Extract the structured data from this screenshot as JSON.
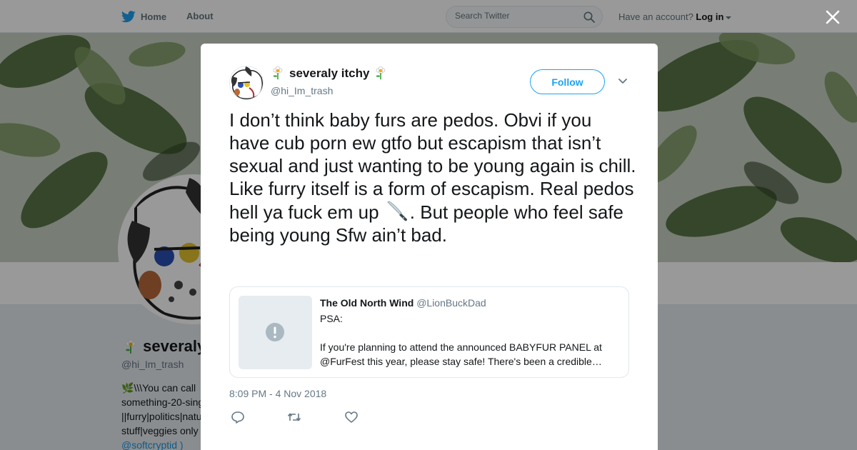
{
  "topbar": {
    "home_label": "Home",
    "about_label": "About",
    "search_placeholder": "Search Twitter",
    "account_prompt": "Have an account?",
    "login_label": "Log in"
  },
  "profile": {
    "name": "severaly",
    "handle": "@hi_Im_trash",
    "bio_lines": [
      "\\\\\\You can call",
      "something-20-sing",
      "||furry|politics|natu",
      "stuff|veggies only",
      "@softcryptid )"
    ]
  },
  "tweet": {
    "author_name": "severaly itchy",
    "author_handle": "@hi_Im_trash",
    "follow_label": "Follow",
    "text_before_emoji": "I don’t think baby furs are pedos. Obvi if you have cub porn ew gtfo but escapism that isn’t sexual and just wanting to be young again is chill. Like furry itself is a form of escapism. Real pedos hell ya fuck em up",
    "text_after_emoji": ". But people who feel safe being young Sfw ain’t bad.",
    "emoji_name": "knife-emoji",
    "timestamp": "8:09 PM - 4 Nov 2018",
    "quoted": {
      "name": "The Old North Wind",
      "handle": "@LionBuckDad",
      "lines": [
        "PSA:",
        "",
        "If you're planning to attend the announced BABYFUR PANEL at",
        "@FurFest this year, please stay safe!  There's been a credible…"
      ]
    }
  },
  "icons": {
    "twitter_bird": "twitter-bird-icon",
    "search": "search-icon",
    "close": "close-icon",
    "chevron": "chevron-down-icon",
    "reply": "reply-icon",
    "retweet": "retweet-icon",
    "like": "heart-icon",
    "warning": "warning-icon"
  },
  "colors": {
    "brand": "#1da1f2",
    "secondary_text": "#657786",
    "background": "#e6ecf0"
  }
}
